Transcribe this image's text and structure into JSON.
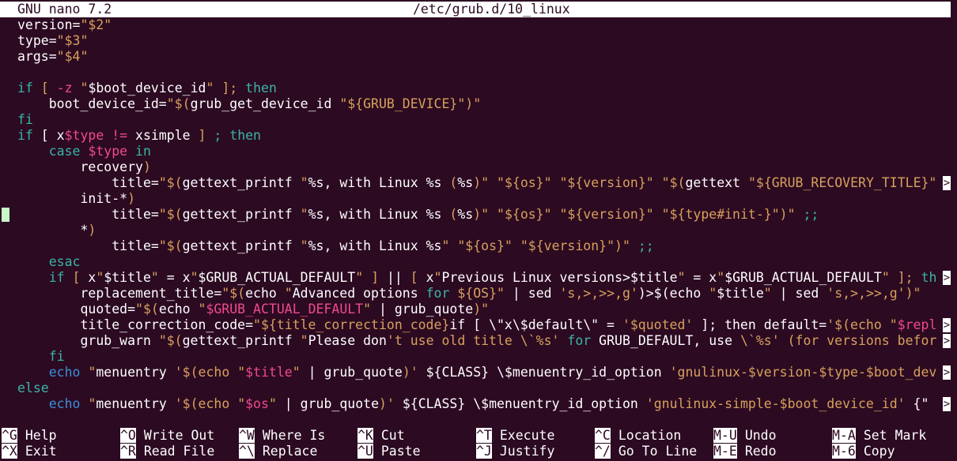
{
  "titlebar": {
    "app": "GNU nano 7.2",
    "file": "/etc/grub.d/10_linux"
  },
  "colors": {
    "background": "#2c0a22",
    "text": "#ffffff",
    "keyword": "#39b5a5",
    "builtin": "#3b8ed8",
    "string": "#d7a15c",
    "variable": "#f04a8d",
    "cursor": "#c8f7c8"
  },
  "editor": {
    "lines": [
      {
        "segs": [
          [
            "",
            "version="
          ],
          [
            "s",
            "\"$2\""
          ]
        ]
      },
      {
        "segs": [
          [
            "",
            "type="
          ],
          [
            "s",
            "\"$3\""
          ]
        ]
      },
      {
        "segs": [
          [
            "",
            "args="
          ],
          [
            "s",
            "\"$4\""
          ]
        ]
      },
      {
        "segs": []
      },
      {
        "segs": [
          [
            "k",
            "if"
          ],
          [
            "",
            " "
          ],
          [
            "s",
            "["
          ],
          [
            "",
            " "
          ],
          [
            "v",
            "-z"
          ],
          [
            "",
            " "
          ],
          [
            "s",
            "\""
          ],
          [
            "",
            "$boot_device_id"
          ],
          [
            "s",
            "\""
          ],
          [
            "",
            " "
          ],
          [
            "s",
            "];"
          ],
          [
            "",
            " "
          ],
          [
            "k",
            "then"
          ]
        ]
      },
      {
        "segs": [
          [
            "",
            "    boot_device_id="
          ],
          [
            "s",
            "\"$("
          ],
          [
            "",
            "grub_get_device_id "
          ],
          [
            "s",
            "\"${GRUB_DEVICE}\")\""
          ]
        ]
      },
      {
        "segs": [
          [
            "k",
            "fi"
          ]
        ]
      },
      {
        "segs": [
          [
            "k",
            "if"
          ],
          [
            "",
            " [ x"
          ],
          [
            "v",
            "$type"
          ],
          [
            "",
            " "
          ],
          [
            "v",
            "!="
          ],
          [
            "",
            " xsimple "
          ],
          [
            "s",
            "]"
          ],
          [
            "",
            " "
          ],
          [
            "k",
            "; then"
          ]
        ]
      },
      {
        "segs": [
          [
            "",
            "    "
          ],
          [
            "k",
            "case"
          ],
          [
            "",
            " "
          ],
          [
            "v",
            "$type"
          ],
          [
            "",
            " "
          ],
          [
            "k",
            "in"
          ]
        ]
      },
      {
        "segs": [
          [
            "",
            "        recovery"
          ],
          [
            "s",
            ")"
          ]
        ]
      },
      {
        "segs": [
          [
            "",
            "            title="
          ],
          [
            "s",
            "\"$("
          ],
          [
            "",
            "gettext_printf "
          ],
          [
            "s",
            "\""
          ],
          [
            "",
            "%s, with Linux %s "
          ],
          [
            "s",
            "("
          ],
          [
            "",
            "%s"
          ],
          [
            "s",
            ")\""
          ],
          [
            "",
            " "
          ],
          [
            "s",
            "\"${os}\""
          ],
          [
            "",
            " "
          ],
          [
            "s",
            "\"${version}\""
          ],
          [
            "",
            " "
          ],
          [
            "s",
            "\"$("
          ],
          [
            "",
            "gettext "
          ],
          [
            "s",
            "\"${GRUB_RECOVERY_TITLE}\""
          ]
        ],
        "more": ">"
      },
      {
        "segs": [
          [
            "",
            "        init-*"
          ],
          [
            "s",
            ")"
          ]
        ]
      },
      {
        "segs": [
          [
            "",
            "            title="
          ],
          [
            "s",
            "\"$("
          ],
          [
            "",
            "gettext_printf "
          ],
          [
            "s",
            "\""
          ],
          [
            "",
            "%s, with Linux %s "
          ],
          [
            "s",
            "("
          ],
          [
            "",
            "%s"
          ],
          [
            "s",
            ")\""
          ],
          [
            "",
            " "
          ],
          [
            "s",
            "\"${os}\""
          ],
          [
            "",
            " "
          ],
          [
            "s",
            "\"${version}\""
          ],
          [
            "",
            " "
          ],
          [
            "s",
            "\"${type#init-}\")\""
          ],
          [
            "",
            " "
          ],
          [
            "k",
            ";;"
          ]
        ],
        "cursor": true
      },
      {
        "segs": [
          [
            "",
            "        *"
          ],
          [
            "s",
            ")"
          ]
        ]
      },
      {
        "segs": [
          [
            "",
            "            title="
          ],
          [
            "s",
            "\"$("
          ],
          [
            "",
            "gettext_printf "
          ],
          [
            "s",
            "\""
          ],
          [
            "",
            "%s, with Linux %s"
          ],
          [
            "s",
            "\""
          ],
          [
            "",
            " "
          ],
          [
            "s",
            "\"${os}\""
          ],
          [
            "",
            " "
          ],
          [
            "s",
            "\"${version}\")\""
          ],
          [
            "",
            " "
          ],
          [
            "k",
            ";;"
          ]
        ]
      },
      {
        "segs": [
          [
            "",
            "    "
          ],
          [
            "k",
            "esac"
          ]
        ]
      },
      {
        "segs": [
          [
            "",
            "    "
          ],
          [
            "k",
            "if"
          ],
          [
            "",
            " "
          ],
          [
            "s",
            "["
          ],
          [
            "",
            " x"
          ],
          [
            "s",
            "\""
          ],
          [
            "",
            "$title"
          ],
          [
            "s",
            "\""
          ],
          [
            "",
            " = x"
          ],
          [
            "s",
            "\""
          ],
          [
            "",
            "$GRUB_ACTUAL_DEFAULT"
          ],
          [
            "s",
            "\""
          ],
          [
            "",
            " "
          ],
          [
            "s",
            "]"
          ],
          [
            "",
            " || "
          ],
          [
            "s",
            "["
          ],
          [
            "",
            " x"
          ],
          [
            "s",
            "\""
          ],
          [
            "",
            "Previous Linux versions>$title"
          ],
          [
            "s",
            "\""
          ],
          [
            "",
            " = x"
          ],
          [
            "s",
            "\""
          ],
          [
            "",
            "$GRUB_ACTUAL_DEFAULT"
          ],
          [
            "s",
            "\""
          ],
          [
            "",
            " "
          ],
          [
            "s",
            "];"
          ],
          [
            "",
            " "
          ],
          [
            "k",
            "th"
          ]
        ],
        "more": ">"
      },
      {
        "segs": [
          [
            "",
            "        replacement_title="
          ],
          [
            "s",
            "\"$("
          ],
          [
            "",
            "echo "
          ],
          [
            "s",
            "\""
          ],
          [
            "",
            "Advanced options "
          ],
          [
            "k",
            "for"
          ],
          [
            "",
            " "
          ],
          [
            "s",
            "${OS}\""
          ],
          [
            "",
            " | sed "
          ],
          [
            "s",
            "'s,>,>>,g'"
          ],
          [
            "",
            ")>$(echo "
          ],
          [
            "s",
            "\""
          ],
          [
            "",
            "$title"
          ],
          [
            "s",
            "\""
          ],
          [
            "",
            " | sed "
          ],
          [
            "s",
            "'s,>,>>,g'"
          ],
          [
            "s",
            ")\""
          ]
        ]
      },
      {
        "segs": [
          [
            "",
            "        quoted="
          ],
          [
            "s",
            "\"$("
          ],
          [
            "",
            "echo "
          ],
          [
            "s",
            "\""
          ],
          [
            "v",
            "$GRUB_ACTUAL_DEFAULT"
          ],
          [
            "s",
            "\""
          ],
          [
            "",
            " | grub_quote"
          ],
          [
            "s",
            ")\""
          ]
        ]
      },
      {
        "segs": [
          [
            "",
            "        title_correction_code="
          ],
          [
            "s",
            "\"${title_correction_code}"
          ],
          [
            "",
            "if [ \\\"x\\$default\\\" = "
          ],
          [
            "s",
            "'$quoted'"
          ],
          [
            "",
            " ]; then default="
          ],
          [
            "s",
            "'$(echo "
          ],
          [
            "s",
            "\""
          ],
          [
            "v",
            "$repl"
          ]
        ],
        "more": ">"
      },
      {
        "segs": [
          [
            "",
            "        grub_warn "
          ],
          [
            "s",
            "\"$("
          ],
          [
            "",
            "gettext_printf "
          ],
          [
            "s",
            "\""
          ],
          [
            "",
            "Please don"
          ],
          [
            "s",
            "'t use old title \\`%s'"
          ],
          [
            "",
            " "
          ],
          [
            "k",
            "for"
          ],
          [
            "",
            " GRUB_DEFAULT, use "
          ],
          [
            "s",
            "\\`%s'"
          ],
          [
            "",
            " "
          ],
          [
            "s",
            "(for versions befor"
          ]
        ],
        "more": ">"
      },
      {
        "segs": [
          [
            "",
            "    "
          ],
          [
            "k",
            "fi"
          ]
        ]
      },
      {
        "segs": [
          [
            "",
            "    "
          ],
          [
            "b",
            "echo"
          ],
          [
            "",
            " "
          ],
          [
            "s",
            "\""
          ],
          [
            "",
            "menuentry "
          ],
          [
            "s",
            "'$(echo \""
          ],
          [
            "v",
            "$title"
          ],
          [
            "s",
            "\""
          ],
          [
            "",
            " | grub_quote"
          ],
          [
            "s",
            ")'"
          ],
          [
            "",
            " ${CLASS} \\$menuentry_id_option "
          ],
          [
            "s",
            "'gnulinux-$version-$type-$boot_dev"
          ]
        ],
        "more": ">"
      },
      {
        "segs": [
          [
            "k",
            "else"
          ]
        ]
      },
      {
        "segs": [
          [
            "",
            "    "
          ],
          [
            "b",
            "echo"
          ],
          [
            "",
            " "
          ],
          [
            "s",
            "\""
          ],
          [
            "",
            "menuentry "
          ],
          [
            "s",
            "'$(echo \""
          ],
          [
            "v",
            "$os"
          ],
          [
            "s",
            "\""
          ],
          [
            "",
            " | grub_quote"
          ],
          [
            "s",
            ")'"
          ],
          [
            "",
            " ${CLASS} \\$menuentry_id_option "
          ],
          [
            "s",
            "'gnulinux-simple-$boot_device_id'"
          ],
          [
            "",
            " {\" "
          ]
        ],
        "more": ">"
      }
    ]
  },
  "shortcuts": {
    "row1": [
      {
        "key": "^G",
        "label": "Help",
        "icon": "help-icon"
      },
      {
        "key": "^O",
        "label": "Write Out",
        "icon": "write-out-icon"
      },
      {
        "key": "^W",
        "label": "Where Is",
        "icon": "where-is-icon"
      },
      {
        "key": "^K",
        "label": "Cut",
        "icon": "cut-icon"
      },
      {
        "key": "^T",
        "label": "Execute",
        "icon": "execute-icon"
      },
      {
        "key": "^C",
        "label": "Location",
        "icon": "location-icon"
      },
      {
        "key": "M-U",
        "label": "Undo",
        "icon": "undo-icon"
      },
      {
        "key": "M-A",
        "label": "Set Mark",
        "icon": "set-mark-icon"
      }
    ],
    "row2": [
      {
        "key": "^X",
        "label": "Exit",
        "icon": "exit-icon"
      },
      {
        "key": "^R",
        "label": "Read File",
        "icon": "read-file-icon"
      },
      {
        "key": "^\\",
        "label": "Replace",
        "icon": "replace-icon"
      },
      {
        "key": "^U",
        "label": "Paste",
        "icon": "paste-icon"
      },
      {
        "key": "^J",
        "label": "Justify",
        "icon": "justify-icon"
      },
      {
        "key": "^/",
        "label": "Go To Line",
        "icon": "go-to-line-icon"
      },
      {
        "key": "M-E",
        "label": "Redo",
        "icon": "redo-icon"
      },
      {
        "key": "M-6",
        "label": "Copy",
        "icon": "copy-icon"
      }
    ]
  }
}
